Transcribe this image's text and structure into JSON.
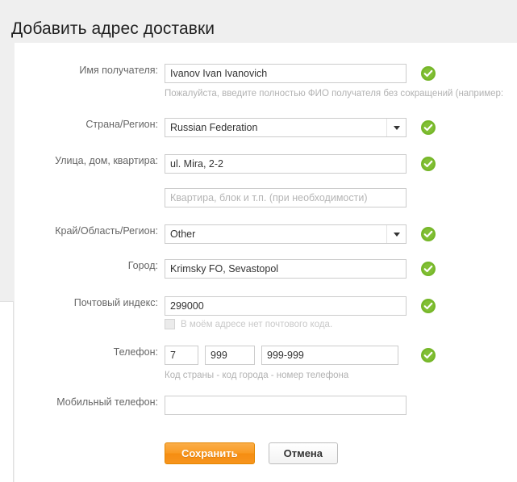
{
  "page": {
    "title": "Добавить адрес доставки"
  },
  "form": {
    "recipient": {
      "label": "Имя получателя:",
      "value": "Ivanov Ivan Ivanovich",
      "hint": "Пожалуйста, введите полностью ФИО получателя без сокращений (например:",
      "valid": true
    },
    "country": {
      "label": "Страна/Регион:",
      "value": "Russian Federation",
      "valid": true
    },
    "street": {
      "label": "Улица, дом, квартира:",
      "value": "ul. Mira, 2-2",
      "valid": true
    },
    "apartment": {
      "placeholder": "Квартира, блок и т.п. (при необходимости)",
      "value": ""
    },
    "region": {
      "label": "Край/Область/Регион:",
      "value": "Other",
      "valid": true
    },
    "city": {
      "label": "Город:",
      "value": "Krimsky FO, Sevastopol",
      "valid": true
    },
    "zip": {
      "label": "Почтовый индекс:",
      "value": "299000",
      "valid": true,
      "no_zip_label": "В моём адресе нет почтового кода."
    },
    "phone": {
      "label": "Телефон:",
      "country_code": "7",
      "city_code": "999",
      "number": "999-999",
      "hint": "Код страны - код города - номер телефона",
      "valid": true
    },
    "mobile": {
      "label": "Мобильный телефон:",
      "value": ""
    }
  },
  "actions": {
    "save_label": "Сохранить",
    "cancel_label": "Отмена"
  },
  "colors": {
    "accent_orange": "#f7941d",
    "valid_green": "#76b729",
    "page_bg": "#efefef",
    "panel_bg": "#ffffff",
    "label_text": "#666666",
    "hint_text": "#b2b2b2"
  },
  "icons": {
    "valid_check": "check-circle-icon",
    "dropdown": "chevron-down-icon"
  }
}
